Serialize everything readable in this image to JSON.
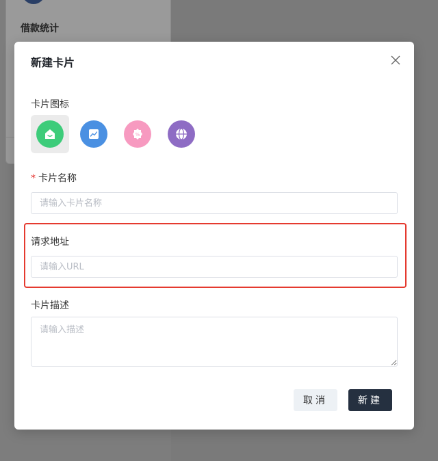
{
  "background": {
    "card_title": "借款统计"
  },
  "modal": {
    "title": "新建卡片",
    "icon_section_label": "卡片图标",
    "icons": [
      {
        "name": "home-icon",
        "color": "#3dcc7a",
        "selected": true
      },
      {
        "name": "trend-chart-icon",
        "color": "#4a90e2",
        "selected": false
      },
      {
        "name": "discount-badge-icon",
        "color": "#f79ac0",
        "selected": false
      },
      {
        "name": "globe-icon",
        "color": "#8e6cc4",
        "selected": false
      }
    ],
    "name_field": {
      "required_mark": "*",
      "label": "卡片名称",
      "placeholder": "请输入卡片名称",
      "value": ""
    },
    "url_field": {
      "label": "请求地址",
      "placeholder": "请输入URL",
      "value": ""
    },
    "desc_field": {
      "label": "卡片描述",
      "placeholder": "请输入描述",
      "value": ""
    },
    "buttons": {
      "cancel": "取消",
      "create": "新建"
    }
  },
  "colors": {
    "highlight": "#e53a2f",
    "primary_button": "#253040",
    "required": "#e5322d"
  }
}
